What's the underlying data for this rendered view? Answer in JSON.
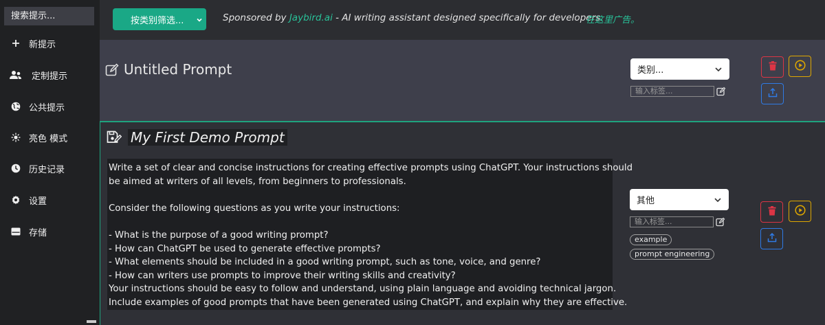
{
  "sidebar": {
    "search_label": "搜索提示...",
    "items": [
      {
        "label": "新提示",
        "icon": "plus-icon"
      },
      {
        "label": "定制提示",
        "icon": "user-group-icon"
      },
      {
        "label": "公共提示",
        "icon": "globe-icon"
      },
      {
        "label": "亮色 模式",
        "icon": "sun-icon"
      },
      {
        "label": "历史记录",
        "icon": "clock-icon"
      },
      {
        "label": "设置",
        "icon": "gear-icon"
      },
      {
        "label": "存储",
        "icon": "storage-icon"
      }
    ]
  },
  "header": {
    "category_filter_label": "按类别筛选...",
    "sponsor_prefix": "Sponsored by ",
    "sponsor_name": "Jaybird.ai",
    "sponsor_suffix": " - AI writing assistant designed specifically for developers.",
    "ad_link": "在这里广告。"
  },
  "prompts": [
    {
      "title": "Untitled Prompt",
      "category": "类别...",
      "tag_placeholder": "输入标签..."
    },
    {
      "title": "My First Demo Prompt",
      "category": "其他",
      "tag_placeholder": "输入标签...",
      "tags": [
        "example",
        "prompt engineering"
      ],
      "text_lines": [
        "Write a set of clear and concise instructions for creating effective prompts using ChatGPT. Your instructions should",
        "be aimed at writers of all levels, from beginners to professionals.",
        "",
        "Consider the following questions as you write your instructions:",
        "",
        "- What is the purpose of a good writing prompt?",
        "- How can ChatGPT be used to generate effective prompts?",
        "- What elements should be included in a good writing prompt, such as tone, voice, and genre?",
        "- How can writers use prompts to improve their writing skills and creativity?",
        "Your instructions should be easy to follow and understand, using plain language and avoiding technical jargon.",
        "Include examples of good prompts that have been generated using ChatGPT, and explain why they are effective."
      ]
    }
  ],
  "colors": {
    "accent": "#1aa886",
    "danger": "#dc3545",
    "warning": "#e0a800",
    "primary": "#2f7be6"
  }
}
